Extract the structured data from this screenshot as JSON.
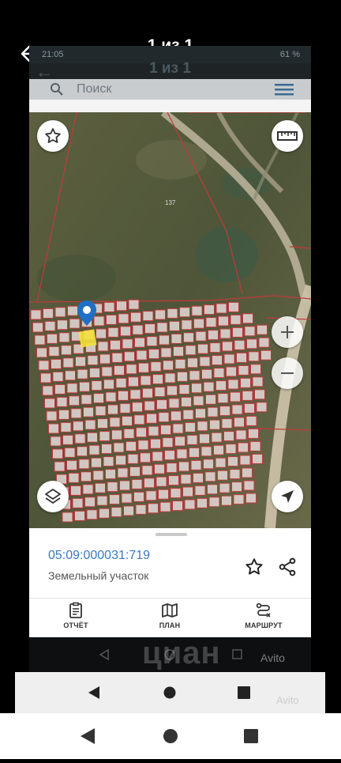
{
  "viewer": {
    "title": "1 из 1"
  },
  "inner_app": {
    "status_time": "21:05",
    "status_battery": "61 %",
    "title": "1 из 1",
    "search_placeholder": "Поиск"
  },
  "map": {
    "parcel_label": "137"
  },
  "info_panel": {
    "cadastral_number": "05:09:000031:719",
    "object_type": "Земельный участок"
  },
  "bottom_nav": {
    "items": [
      {
        "label": "ОТЧЁТ",
        "icon": "report-icon"
      },
      {
        "label": "ПЛАН",
        "icon": "map-plan-icon"
      },
      {
        "label": "МАРШРУТ",
        "icon": "route-icon"
      }
    ]
  },
  "watermarks": {
    "cian": "циан",
    "avito": "Avito",
    "avito_small": "Avito"
  },
  "colors": {
    "accent": "#3a79c4",
    "parcel_red": "#c23a3a",
    "highlight": "#f3e23b"
  }
}
